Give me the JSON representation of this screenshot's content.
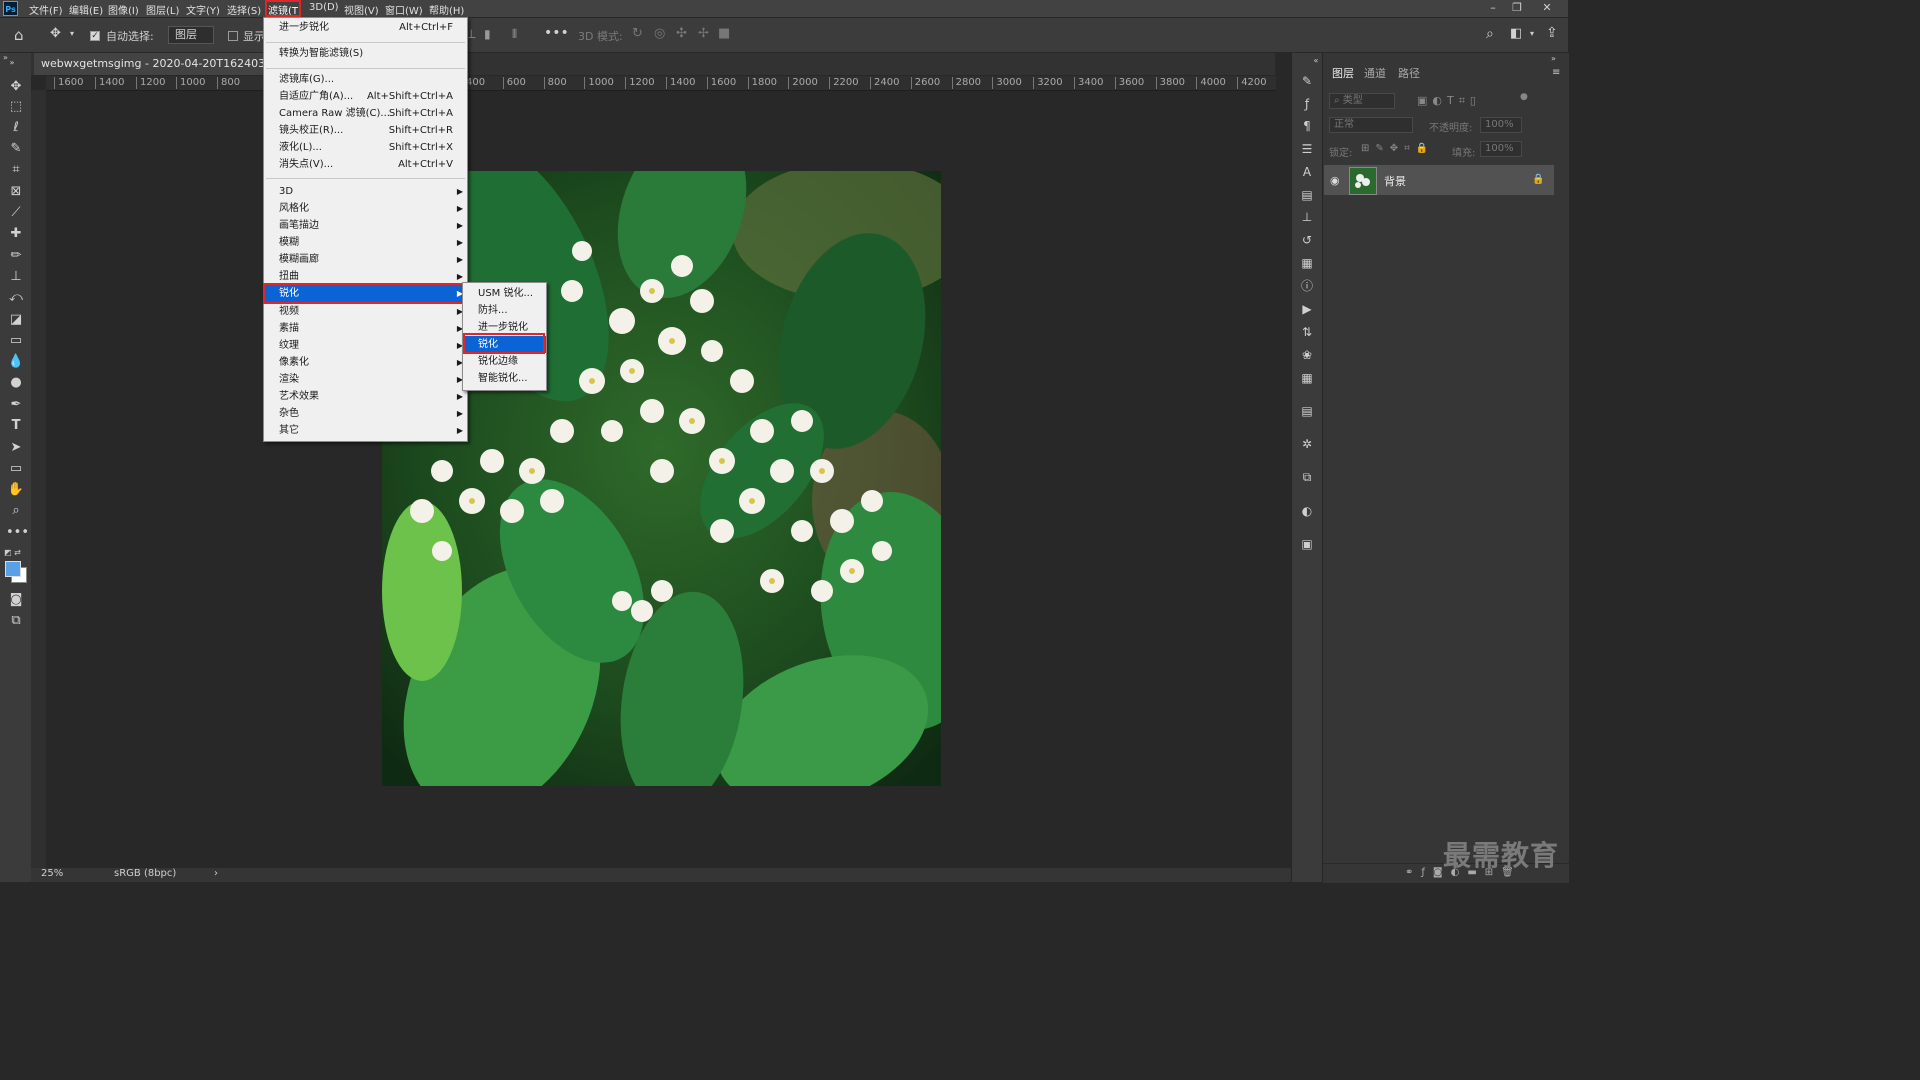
{
  "menubar": {
    "items": [
      "文件(F)",
      "编辑(E)",
      "图像(I)",
      "图层(L)",
      "文字(Y)",
      "选择(S)",
      "滤镜(T)",
      "3D(D)",
      "视图(V)",
      "窗口(W)",
      "帮助(H)"
    ],
    "logo": "Ps"
  },
  "options_bar": {
    "auto_select_label": "自动选择:",
    "auto_select_target": "图层",
    "show_transform_label": "显示",
    "mode_3d_label": "3D 模式:"
  },
  "document": {
    "tab_title": "webwxgetmsgimg - 2020-04-20T162403.959.jp",
    "zoom": "25%",
    "color_profile": "sRGB (8bpc)"
  },
  "rulers": {
    "h_ticks_left": [
      "1600",
      "1400",
      "1200",
      "1000",
      "800"
    ],
    "h_ticks_right": [
      "400",
      "600",
      "800",
      "1000",
      "1200",
      "1400",
      "1600",
      "1800",
      "2000",
      "2200",
      "2400",
      "2600",
      "2800",
      "3000",
      "3200",
      "3400",
      "3600",
      "3800",
      "4000",
      "4200"
    ]
  },
  "filter_menu": {
    "items": [
      {
        "label": "进一步锐化",
        "shortcut": "Alt+Ctrl+F"
      },
      {
        "label": "转换为智能滤镜(S)",
        "shortcut": ""
      },
      {
        "label": "滤镜库(G)...",
        "shortcut": ""
      },
      {
        "label": "自适应广角(A)...",
        "shortcut": "Alt+Shift+Ctrl+A"
      },
      {
        "label": "Camera Raw 滤镜(C)...",
        "shortcut": "Shift+Ctrl+A"
      },
      {
        "label": "镜头校正(R)...",
        "shortcut": "Shift+Ctrl+R"
      },
      {
        "label": "液化(L)...",
        "shortcut": "Shift+Ctrl+X"
      },
      {
        "label": "消失点(V)...",
        "shortcut": "Alt+Ctrl+V"
      },
      {
        "label": "3D",
        "shortcut": ""
      },
      {
        "label": "风格化",
        "shortcut": ""
      },
      {
        "label": "画笔描边",
        "shortcut": ""
      },
      {
        "label": "模糊",
        "shortcut": ""
      },
      {
        "label": "模糊画廊",
        "shortcut": ""
      },
      {
        "label": "扭曲",
        "shortcut": ""
      },
      {
        "label": "锐化",
        "shortcut": ""
      },
      {
        "label": "视频",
        "shortcut": ""
      },
      {
        "label": "素描",
        "shortcut": ""
      },
      {
        "label": "纹理",
        "shortcut": ""
      },
      {
        "label": "像素化",
        "shortcut": ""
      },
      {
        "label": "渲染",
        "shortcut": ""
      },
      {
        "label": "艺术效果",
        "shortcut": ""
      },
      {
        "label": "杂色",
        "shortcut": ""
      },
      {
        "label": "其它",
        "shortcut": ""
      }
    ],
    "highlighted": "锐化"
  },
  "sharpen_submenu": {
    "items": [
      "USM 锐化...",
      "防抖...",
      "进一步锐化",
      "锐化",
      "锐化边缘",
      "智能锐化..."
    ],
    "highlighted": "锐化"
  },
  "layers_panel": {
    "tabs": [
      "图层",
      "通道",
      "路径"
    ],
    "filter_placeholder": "类型",
    "blend_mode": "正常",
    "opacity_label": "不透明度:",
    "opacity_value": "100%",
    "lock_label": "锁定:",
    "fill_label": "填充:",
    "fill_value": "100%",
    "layers": [
      {
        "name": "背景",
        "visible": true,
        "locked": true
      }
    ]
  },
  "watermark": "最需教育",
  "colors": {
    "highlight": "#0a64d6",
    "annotation_red": "#e0262b",
    "foreground_swatch": "#5aa0e6",
    "background_swatch": "#ffffff"
  }
}
